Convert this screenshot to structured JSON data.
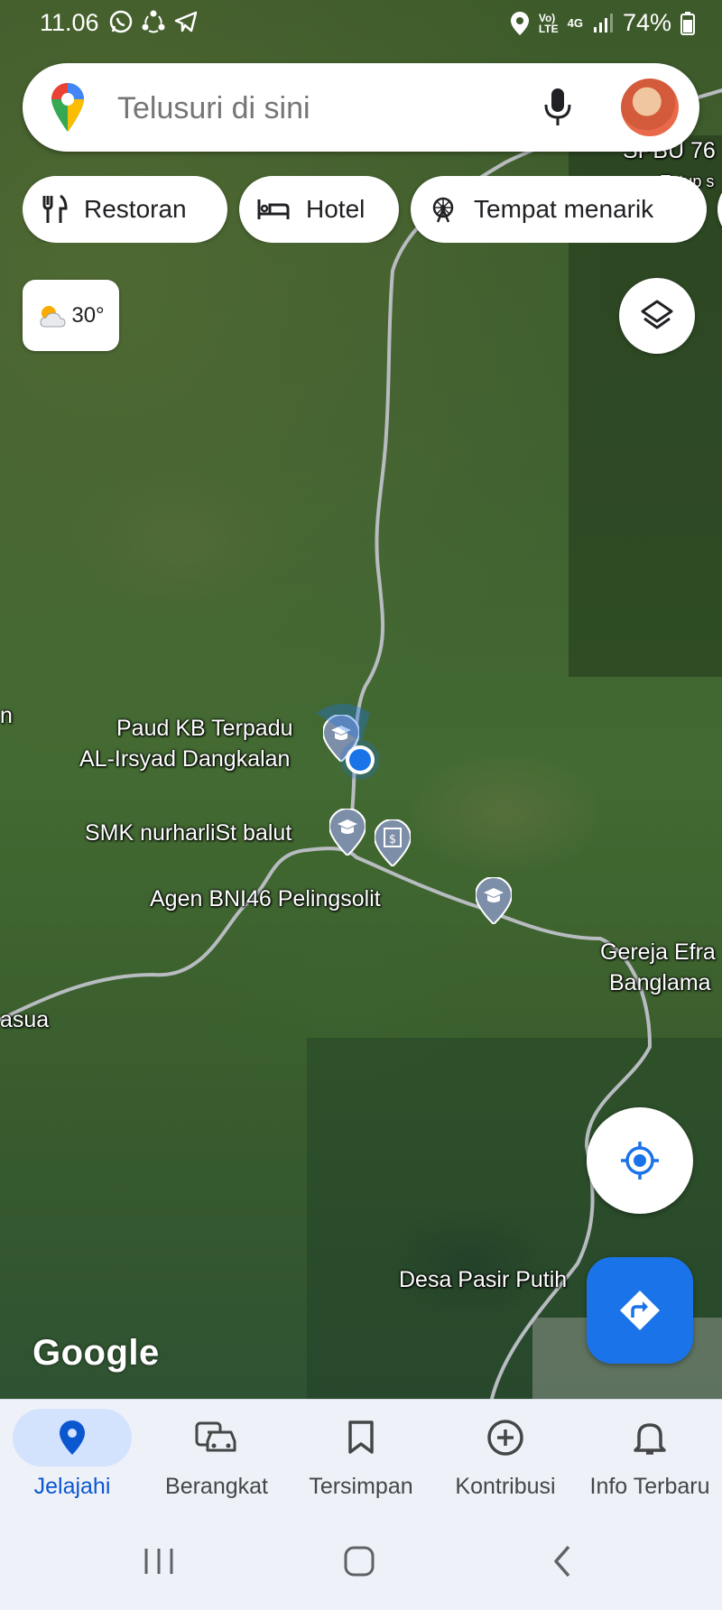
{
  "status_bar": {
    "time": "11.06",
    "network_top": "Vo)",
    "network_bottom": "LTE",
    "network_type": "4G",
    "battery": "74%"
  },
  "search": {
    "placeholder": "Telusuri di sini"
  },
  "chips": [
    {
      "label": "Restoran",
      "icon": "fork-knife-icon"
    },
    {
      "label": "Hotel",
      "icon": "bed-icon"
    },
    {
      "label": "Tempat menarik",
      "icon": "ferris-wheel-icon"
    }
  ],
  "weather": {
    "temperature": "30°",
    "icon": "partly-cloudy-icon"
  },
  "map": {
    "labels": {
      "paud_line1": "Paud KB Terpadu",
      "paud_line2": "AL-Irsyad Dangkalan",
      "smk": "SMK nurharliSt balut",
      "agen": "Agen BNI46 Pelingsolit",
      "gereja_line1": "Gereja Efra",
      "gereja_line2": "Banglama",
      "desa": "Desa Pasir Putih",
      "asua": "asua",
      "spbu": "SPBU 76",
      "tutup": "Tutup s",
      "edge_n": "n"
    },
    "colors": {
      "road": "#b8bcc0",
      "poi_marker": "#7c8ea8",
      "location_dot": "#1a73e8"
    }
  },
  "branding": {
    "google": "Google"
  },
  "bottom_nav": [
    {
      "label": "Jelajahi",
      "icon": "location-pin-icon",
      "active": true
    },
    {
      "label": "Berangkat",
      "icon": "commute-icon",
      "active": false
    },
    {
      "label": "Tersimpan",
      "icon": "bookmark-icon",
      "active": false
    },
    {
      "label": "Kontribusi",
      "icon": "add-circle-icon",
      "active": false
    },
    {
      "label": "Info Terbaru",
      "icon": "bell-icon",
      "active": false
    }
  ]
}
